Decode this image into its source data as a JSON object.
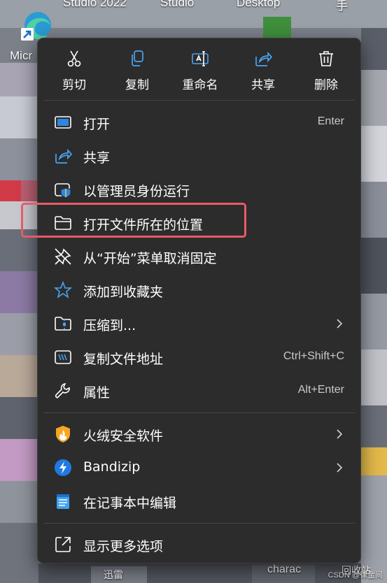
{
  "desktop": {
    "top_labels": [
      "Studio 2022",
      "Studio",
      "Desktop",
      "手"
    ],
    "edge_shortcut_label": "Micr",
    "bottom_labels": [
      "迅雷",
      "charac",
      "回收站"
    ],
    "watermark": "CSDN @律金间"
  },
  "quick_actions": [
    {
      "label": "剪切",
      "icon": "scissors-icon"
    },
    {
      "label": "复制",
      "icon": "copy-icon"
    },
    {
      "label": "重命名",
      "icon": "rename-icon"
    },
    {
      "label": "共享",
      "icon": "share-icon"
    },
    {
      "label": "删除",
      "icon": "trash-icon"
    }
  ],
  "menu_items": [
    {
      "label": "打开",
      "shortcut": "Enter",
      "icon": "open-window-icon"
    },
    {
      "label": "共享",
      "shortcut": "",
      "icon": "share-icon"
    },
    {
      "label": "以管理员身份运行",
      "shortcut": "",
      "icon": "shield-admin-icon"
    },
    {
      "label": "打开文件所在的位置",
      "shortcut": "",
      "icon": "folder-icon",
      "highlighted": true
    },
    {
      "label": "从“开始”菜单取消固定",
      "shortcut": "",
      "icon": "unpin-icon"
    },
    {
      "label": "添加到收藏夹",
      "shortcut": "",
      "icon": "star-icon"
    },
    {
      "label": "压缩到...",
      "shortcut": "",
      "icon": "zip-folder-icon",
      "submenu": true
    },
    {
      "label": "复制文件地址",
      "shortcut": "Ctrl+Shift+C",
      "icon": "copy-path-icon"
    },
    {
      "label": "属性",
      "shortcut": "Alt+Enter",
      "icon": "wrench-icon"
    }
  ],
  "extension_items": [
    {
      "label": "火绒安全软件",
      "icon": "huorong-shield-icon",
      "submenu": true
    },
    {
      "label": "Bandizip",
      "icon": "bandizip-icon",
      "submenu": true
    },
    {
      "label": "在记事本中编辑",
      "icon": "notepad-icon",
      "submenu": false
    }
  ],
  "footer_item": {
    "label": "显示更多选项",
    "icon": "more-options-icon"
  },
  "colors": {
    "menu_background": "#2c2c2c",
    "highlight_border": "#e85b64",
    "accent_blue": "#4aa3f0"
  }
}
